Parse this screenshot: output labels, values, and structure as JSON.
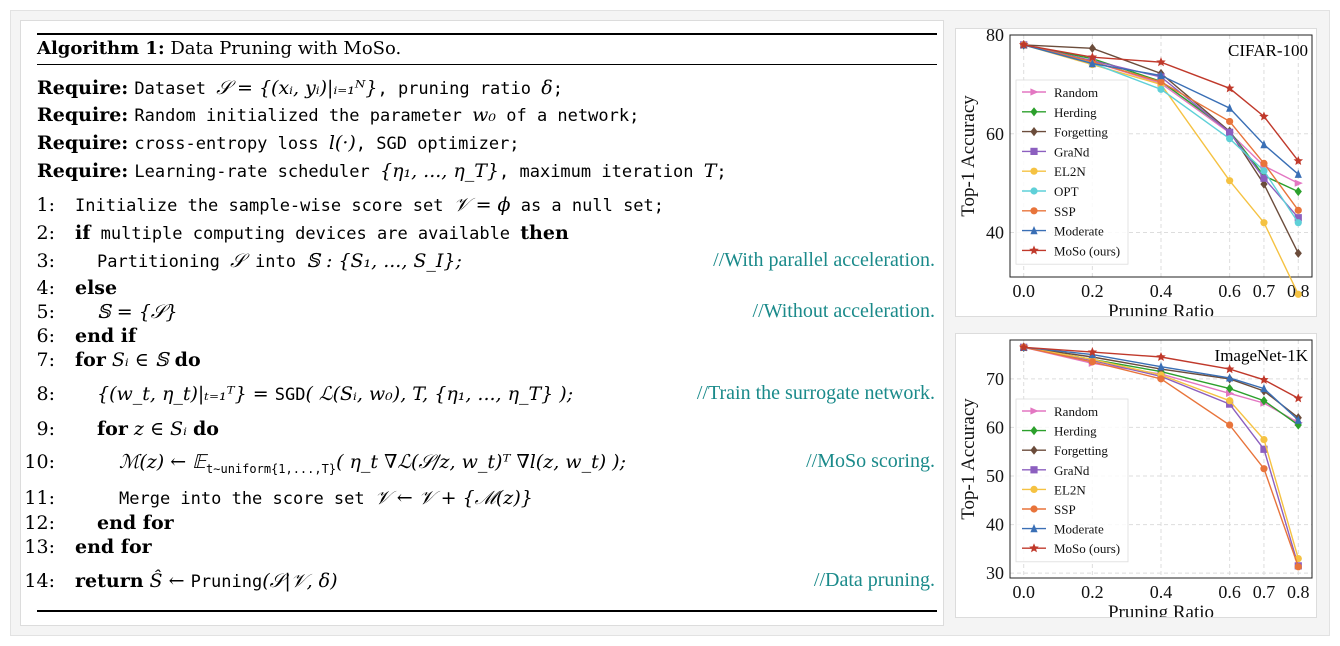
{
  "algorithm": {
    "label": "Algorithm 1:",
    "title": "Data Pruning with MoSo.",
    "requires": [
      {
        "kw": "Require:",
        "pre": "Dataset ",
        "math": "𝒮 = {(xᵢ, yᵢ)|ᵢ₌₁ᴺ}",
        "post": ", pruning ratio ",
        "math2": "δ",
        "end": ";"
      },
      {
        "kw": "Require:",
        "pre": "Random initialized the parameter ",
        "math": "w₀",
        "post": " of a network;",
        "math2": "",
        "end": ""
      },
      {
        "kw": "Require:",
        "pre": "cross-entropy loss ",
        "math": "l(·)",
        "post": ", SGD optimizer;",
        "math2": "",
        "end": ""
      },
      {
        "kw": "Require:",
        "pre": "Learning-rate scheduler ",
        "math": "{η₁, ..., η_T}",
        "post": ", maximum iteration ",
        "math2": "T",
        "end": ";"
      }
    ],
    "steps": [
      {
        "n": "1:",
        "html_kw": "",
        "mono": "Initialize the sample-wise score set ",
        "math": "𝒱 = ϕ",
        "mono2": " as a null set;",
        "kw2": "",
        "comment": ""
      },
      {
        "n": "2:",
        "html_kw": "if",
        "mono": " multiple computing devices are available ",
        "math": "",
        "mono2": "",
        "kw2": "then",
        "comment": ""
      },
      {
        "n": "3:",
        "html_kw": "",
        "mono": "Partitioning ",
        "math": "𝒮",
        "mono2": " into ",
        "math2": "𝕊 : {S₁, ..., S_I};",
        "kw2": "",
        "comment": "//With parallel acceleration."
      },
      {
        "n": "4:",
        "html_kw": "else",
        "mono": "",
        "math": "",
        "mono2": "",
        "kw2": "",
        "comment": ""
      },
      {
        "n": "5:",
        "html_kw": "",
        "mono": "",
        "math": "𝕊 = {𝒮}",
        "mono2": "",
        "kw2": "",
        "comment": "//Without acceleration."
      },
      {
        "n": "6:",
        "html_kw": "end if",
        "mono": "",
        "math": "",
        "mono2": "",
        "kw2": "",
        "comment": ""
      },
      {
        "n": "7:",
        "html_kw": "for",
        "mono": "",
        "math": " Sᵢ ∈ 𝕊 ",
        "mono2": "",
        "kw2": "do",
        "comment": ""
      },
      {
        "n": "8:",
        "html_kw": "",
        "mono": "",
        "math": "{(w_t, η_t)|ₜ₌₁ᵀ} = ",
        "mono2": "SGD",
        "math2": "( ℒ(Sᵢ, w₀),  T,  {η₁, ..., η_T} );",
        "kw2": "",
        "comment": "//Train the surrogate network."
      },
      {
        "n": "9:",
        "html_kw": "for",
        "mono": "",
        "math": " z ∈ Sᵢ ",
        "mono2": "",
        "kw2": "do",
        "comment": ""
      },
      {
        "n": "10:",
        "html_kw": "",
        "mono": "",
        "math": "ℳ(z) ← 𝔼",
        "mono2": "t∼uniform{1,...,T}",
        "math2": "( η_t ∇ℒ(𝒮/z, w_t)ᵀ ∇l(z, w_t) );",
        "kw2": "",
        "comment": "//MoSo scoring."
      },
      {
        "n": "11:",
        "html_kw": "",
        "mono": "Merge into the score set ",
        "math": "𝒱 ← 𝒱 + {ℳ(z)}",
        "mono2": "",
        "kw2": "",
        "comment": ""
      },
      {
        "n": "12:",
        "html_kw": "end for",
        "mono": "",
        "math": "",
        "mono2": "",
        "kw2": "",
        "comment": ""
      },
      {
        "n": "13:",
        "html_kw": "end for",
        "mono": "",
        "math": "",
        "mono2": "",
        "kw2": "",
        "comment": ""
      },
      {
        "n": "14:",
        "html_kw": "return",
        "mono": "",
        "math": " Ŝ ← ",
        "mono2": "Pruning",
        "math2": "(𝒮|𝒱, δ)",
        "kw2": "",
        "comment": "//Data pruning."
      }
    ]
  },
  "chart_data": [
    {
      "type": "line",
      "title": "CIFAR-100",
      "xlabel": "Pruning Ratio",
      "ylabel": "Top-1 Accuracy",
      "x": [
        0.0,
        0.2,
        0.4,
        0.6,
        0.7,
        0.8
      ],
      "x_ticks": [
        "0.0",
        "0.2",
        "0.4",
        "0.6",
        "0.7",
        "0.8"
      ],
      "ylim": [
        31,
        80
      ],
      "y_ticks": [
        40,
        60,
        80
      ],
      "grid": true,
      "legend": "left",
      "series": [
        {
          "name": "Random",
          "color": "#e377c2",
          "marker": "triangle-right",
          "values": [
            78,
            74.6,
            70.2,
            60.2,
            53.5,
            50
          ]
        },
        {
          "name": "Herding",
          "color": "#2ca02c",
          "marker": "diamond",
          "values": [
            78,
            75.2,
            70.6,
            60.5,
            51.5,
            48.3
          ]
        },
        {
          "name": "Forgetting",
          "color": "#6b4c3b",
          "marker": "diamond",
          "values": [
            78,
            77.3,
            72.2,
            60.5,
            49.8,
            35.8
          ]
        },
        {
          "name": "GraNd",
          "color": "#8c5fbf",
          "marker": "square",
          "values": [
            78,
            74.8,
            71.5,
            60.3,
            51,
            43
          ]
        },
        {
          "name": "EL2N",
          "color": "#f5c242",
          "marker": "circle",
          "values": [
            78,
            74,
            70,
            50.5,
            42,
            27.5
          ]
        },
        {
          "name": "OPT",
          "color": "#5fd0d8",
          "marker": "circle",
          "values": [
            78,
            74.3,
            69,
            59,
            52.5,
            42
          ]
        },
        {
          "name": "SSP",
          "color": "#e8743b",
          "marker": "circle",
          "values": [
            78,
            74.6,
            70.5,
            62.5,
            54,
            44.5
          ]
        },
        {
          "name": "Moderate",
          "color": "#3a6fb5",
          "marker": "triangle-up",
          "values": [
            78,
            74.2,
            71.8,
            65.2,
            57.8,
            51.8
          ]
        },
        {
          "name": "MoSo (ours)",
          "color": "#c0392b",
          "marker": "star",
          "values": [
            78,
            75.5,
            74.5,
            69.2,
            63.5,
            54.5
          ]
        }
      ]
    },
    {
      "type": "line",
      "title": "ImageNet-1K",
      "xlabel": "Pruning Ratio",
      "ylabel": "Top-1 Accuracy",
      "x": [
        0.0,
        0.2,
        0.4,
        0.6,
        0.7,
        0.8
      ],
      "x_ticks": [
        "0.0",
        "0.2",
        "0.4",
        "0.6",
        "0.7",
        "0.8"
      ],
      "ylim": [
        29,
        78
      ],
      "y_ticks": [
        30,
        40,
        50,
        60,
        70
      ],
      "grid": true,
      "legend": "left",
      "series": [
        {
          "name": "Random",
          "color": "#e377c2",
          "marker": "triangle-right",
          "values": [
            76.5,
            73.2,
            71,
            67,
            65,
            61
          ]
        },
        {
          "name": "Herding",
          "color": "#2ca02c",
          "marker": "diamond",
          "values": [
            76.5,
            74,
            71.5,
            68,
            65.5,
            60.5
          ]
        },
        {
          "name": "Forgetting",
          "color": "#6b4c3b",
          "marker": "diamond",
          "values": [
            76.5,
            74.5,
            72,
            70,
            67.5,
            62
          ]
        },
        {
          "name": "GraNd",
          "color": "#8c5fbf",
          "marker": "square",
          "values": [
            76.5,
            73.8,
            70.5,
            64.8,
            55.5,
            31.5
          ]
        },
        {
          "name": "EL2N",
          "color": "#f5c242",
          "marker": "circle",
          "values": [
            76.5,
            74,
            70.8,
            65.5,
            57.5,
            33
          ]
        },
        {
          "name": "SSP",
          "color": "#e8743b",
          "marker": "circle",
          "values": [
            76.5,
            73.5,
            70,
            60.5,
            51.5,
            31.3
          ]
        },
        {
          "name": "Moderate",
          "color": "#3a6fb5",
          "marker": "triangle-up",
          "values": [
            76.5,
            75,
            72.5,
            70.2,
            68,
            61.5
          ]
        },
        {
          "name": "MoSo (ours)",
          "color": "#c0392b",
          "marker": "star",
          "values": [
            76.5,
            75.5,
            74.5,
            72,
            69.8,
            66
          ]
        }
      ]
    }
  ]
}
